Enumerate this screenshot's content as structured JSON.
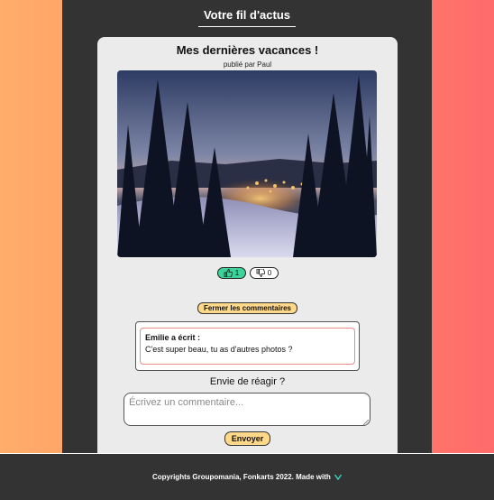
{
  "feed": {
    "title": "Votre fil d'actus"
  },
  "post": {
    "title": "Mes dernières vacances !",
    "author_line": "publié par Paul",
    "image_icon": "winter-landscape-photo",
    "likes": "1",
    "dislikes": "0",
    "like_icon": "thumbs-up-icon",
    "dislike_icon": "thumbs-down-icon",
    "toggle_comments_label": "Fermer les commentaires"
  },
  "comments": [
    {
      "author": "Emilie a écrit :",
      "text": "C'est super beau, tu as d'autres photos ?"
    }
  ],
  "reply": {
    "prompt": "Envie de réagir ?",
    "placeholder": "Écrivez un commentaire...",
    "send_label": "Envoyer"
  },
  "footer": {
    "text": "Copyrights Groupomania, Fonkarts 2022. Made with",
    "icon": "heart-icon"
  },
  "colors": {
    "accent": "#ffd88a",
    "like": "#3bd39a",
    "panel": "#333333",
    "card": "#ebebeb",
    "heart": "#3bd3c4"
  }
}
